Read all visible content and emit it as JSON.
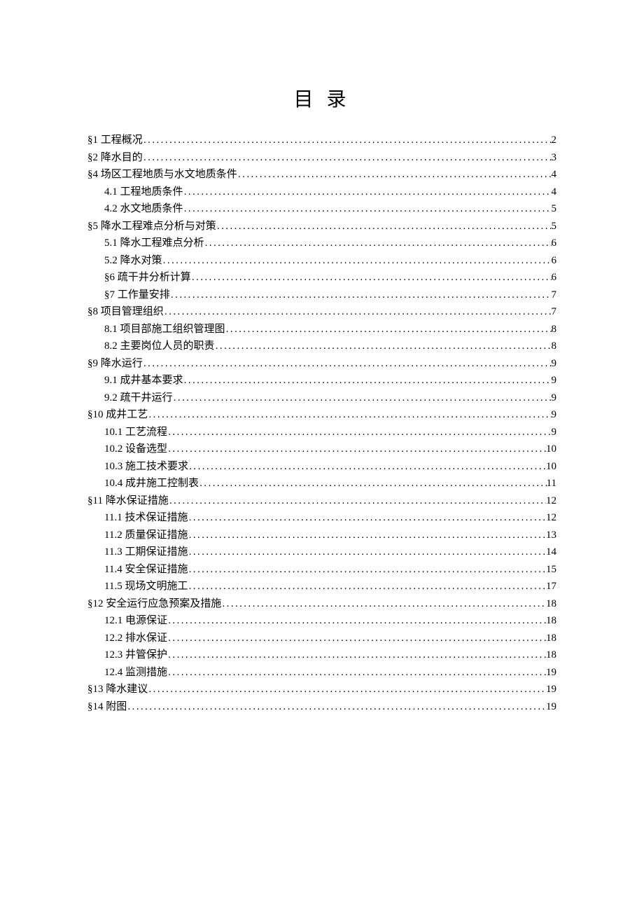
{
  "title": "目 录",
  "entries": [
    {
      "level": 1,
      "label": "§1 工程概况",
      "page": "2"
    },
    {
      "level": 1,
      "label": "§2 降水目的",
      "page": "3"
    },
    {
      "level": 1,
      "label": "§4 场区工程地质与水文地质条件 ",
      "page": "4"
    },
    {
      "level": 2,
      "label": "4.1 工程地质条件 ",
      "page": "4"
    },
    {
      "level": 2,
      "label": "4.2 水文地质条件 ",
      "page": "5"
    },
    {
      "level": 1,
      "label": "§5 降水工程难点分析与对策",
      "page": "5"
    },
    {
      "level": 2,
      "label": "5.1 降水工程难点分析",
      "page": "6"
    },
    {
      "level": 2,
      "label": "5.2 降水对策 ",
      "page": "6"
    },
    {
      "level": 2,
      "label": "§6 疏干井分析计算",
      "page": "6"
    },
    {
      "level": 2,
      "label": "§7 工作量安排 ",
      "page": "7"
    },
    {
      "level": 1,
      "label": "§8 项目管理组织",
      "page": "7"
    },
    {
      "level": 2,
      "label": "8.1 项目部施工组织管理图",
      "page": "8"
    },
    {
      "level": 2,
      "label": "8.2 主要岗位人员的职责 ",
      "page": "8"
    },
    {
      "level": 1,
      "label": "§9 降水运行",
      "page": "9"
    },
    {
      "level": 2,
      "label": "9.1 成井基本要求 ",
      "page": "9"
    },
    {
      "level": 2,
      "label": "9.2 疏干井运行 ",
      "page": "9"
    },
    {
      "level": 1,
      "label": "§10 成井工艺",
      "page": "9"
    },
    {
      "level": 2,
      "label": "10.1 工艺流程 ",
      "page": "9"
    },
    {
      "level": 2,
      "label": "10.2 设备选型 ",
      "page": "10"
    },
    {
      "level": 2,
      "label": "10.3 施工技术要求 ",
      "page": "10"
    },
    {
      "level": 2,
      "label": "10.4 成井施工控制表",
      "page": "11"
    },
    {
      "level": 1,
      "label": "§11 降水保证措施",
      "page": "12"
    },
    {
      "level": 2,
      "label": "11.1 技术保证措施 ",
      "page": "12"
    },
    {
      "level": 2,
      "label": "11.2 质量保证措施 ",
      "page": "13"
    },
    {
      "level": 2,
      "label": "11.3 工期保证措施 ",
      "page": "14"
    },
    {
      "level": 2,
      "label": "11.4 安全保证措施 ",
      "page": "15"
    },
    {
      "level": 2,
      "label": "11.5 现场文明施工",
      "page": "17"
    },
    {
      "level": 1,
      "label": "§12 安全运行应急预案及措施",
      "page": "18"
    },
    {
      "level": 2,
      "label": "12.1 电源保证 ",
      "page": "18"
    },
    {
      "level": 2,
      "label": "12.2 排水保证 ",
      "page": "18"
    },
    {
      "level": 2,
      "label": "12.3 井管保护 ",
      "page": "18"
    },
    {
      "level": 2,
      "label": "12.4 监测措施 ",
      "page": "19"
    },
    {
      "level": 1,
      "label": "§13 降水建议",
      "page": "19"
    },
    {
      "level": 1,
      "label": "§14 附图",
      "page": "19"
    }
  ]
}
